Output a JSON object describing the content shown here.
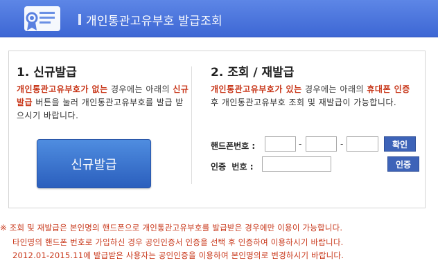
{
  "header": {
    "title": "개인통관고유부호 발급조회",
    "icon": "certificate-icon",
    "color": "#4a73dc"
  },
  "new_issue": {
    "title": "1. 신규발급",
    "desc": {
      "part1": "개인통관고유부호가 없는",
      "part2": " 경우에는 아래의 ",
      "part3": "신규발급",
      "part4": " 버튼을 눌러 개인통관고유부호를 발급 받으시기 바랍니다."
    },
    "button_label": "신규발급"
  },
  "reissue": {
    "title": "2. 조회 / 재발급",
    "desc": {
      "part1": "개인통관고유부호가 있는",
      "part2": " 경우에는 아래의 ",
      "part3": "휴대폰 인증",
      "part4": " 후 개인통관고유부호 조회 및 재발급이 가능합니다."
    },
    "phone_label": "핸드폰번호 :",
    "phone_separator": "-",
    "confirm_label": "확인",
    "auth_label": "인증  번호 :",
    "auth_button_label": "인증",
    "phone_values": [
      "",
      "",
      ""
    ],
    "auth_value": ""
  },
  "notice": {
    "line1": "※ 조회 및 재발급은 본인명의 핸드폰으로 개인통관고유부호를 발급받은 경우에만 이용이 가능합니다.",
    "line2": "타인명의 핸드폰 번호로 가입하신 경우 공인인증서 인증을 선택 후 인증하여 이용하시기 바랍니다.",
    "line3": "2012.01-2015.11에 발급받은 사용자는 공인인증을 이용하여 본인명의로 변경하시기 바랍니다.",
    "color": "#c8371a"
  }
}
